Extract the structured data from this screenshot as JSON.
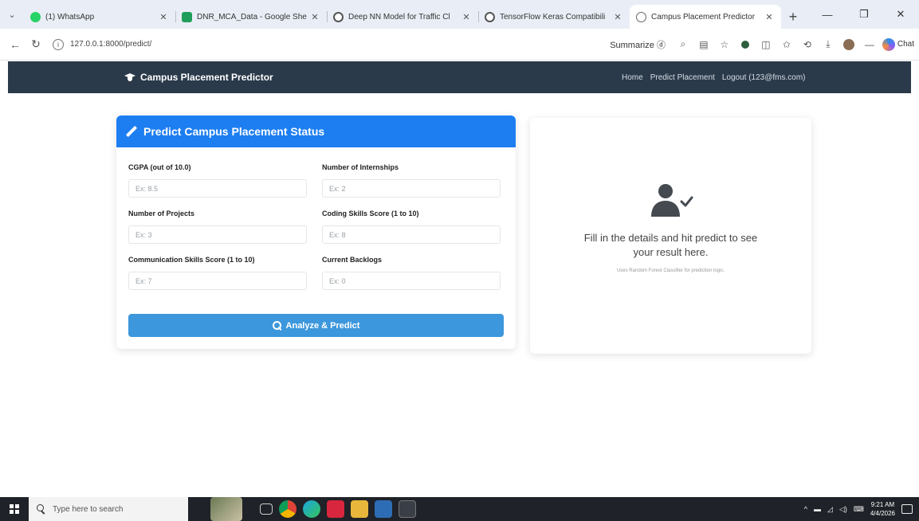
{
  "browser": {
    "tabs": [
      {
        "title": "(1) WhatsApp",
        "favicon_color": "#25d366",
        "active": false
      },
      {
        "title": "DNR_MCA_Data - Google She",
        "favicon_color": "#1e9e5a",
        "active": false
      },
      {
        "title": "Deep NN Model for Traffic Cl",
        "favicon_color": "#555555",
        "active": false
      },
      {
        "title": "TensorFlow Keras Compatibili",
        "favicon_color": "#555555",
        "active": false
      },
      {
        "title": "Campus Placement Predictor",
        "favicon_color": "#666666",
        "active": true
      }
    ],
    "url": "127.0.0.1:8000/predict/",
    "summarize_label": "Summarize",
    "chat_label": "Chat"
  },
  "app": {
    "brand": "Campus Placement Predictor",
    "nav": {
      "home": "Home",
      "predict": "Predict Placement",
      "logout": "Logout (123@fms.com)"
    },
    "colors": {
      "navbar": "#2b3a4a",
      "card_header": "#1d7ef2",
      "button": "#3c97dc"
    }
  },
  "form": {
    "title": "Predict Campus Placement Status",
    "fields": {
      "cgpa": {
        "label": "CGPA (out of 10.0)",
        "placeholder": "Ex: 8.5",
        "value": ""
      },
      "internships": {
        "label": "Number of Internships",
        "placeholder": "Ex: 2",
        "value": ""
      },
      "projects": {
        "label": "Number of Projects",
        "placeholder": "Ex: 3",
        "value": ""
      },
      "coding": {
        "label": "Coding Skills Score (1 to 10)",
        "placeholder": "Ex: 8",
        "value": ""
      },
      "communication": {
        "label": "Communication Skills Score (1 to 10)",
        "placeholder": "Ex: 7",
        "value": ""
      },
      "backlogs": {
        "label": "Current Backlogs",
        "placeholder": "Ex: 0",
        "value": ""
      }
    },
    "submit_label": "Analyze & Predict"
  },
  "result": {
    "line1": "Fill in the details and hit predict to see",
    "line2": "your result here.",
    "note": "Uses Random Forest Classifier for prediction logic."
  },
  "taskbar": {
    "search_placeholder": "Type here to search",
    "time": "9:21 AM",
    "date": "4/4/2026"
  }
}
